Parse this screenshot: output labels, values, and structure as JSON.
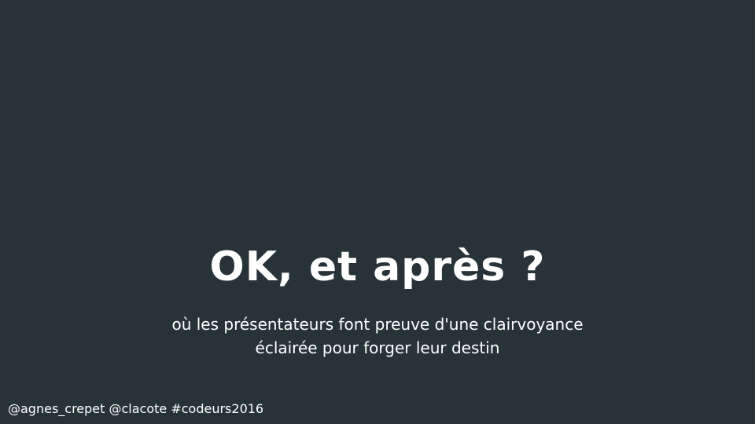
{
  "slide": {
    "title": "OK, et après ?",
    "subtitle_lines": [
      "où les présentateurs font preuve d'une clairvoyance",
      "éclairée pour forger leur destin"
    ],
    "footer": "@agnes_crepet @clacote #codeurs2016"
  },
  "colors": {
    "background": "#283339",
    "text": "#ffffff"
  }
}
